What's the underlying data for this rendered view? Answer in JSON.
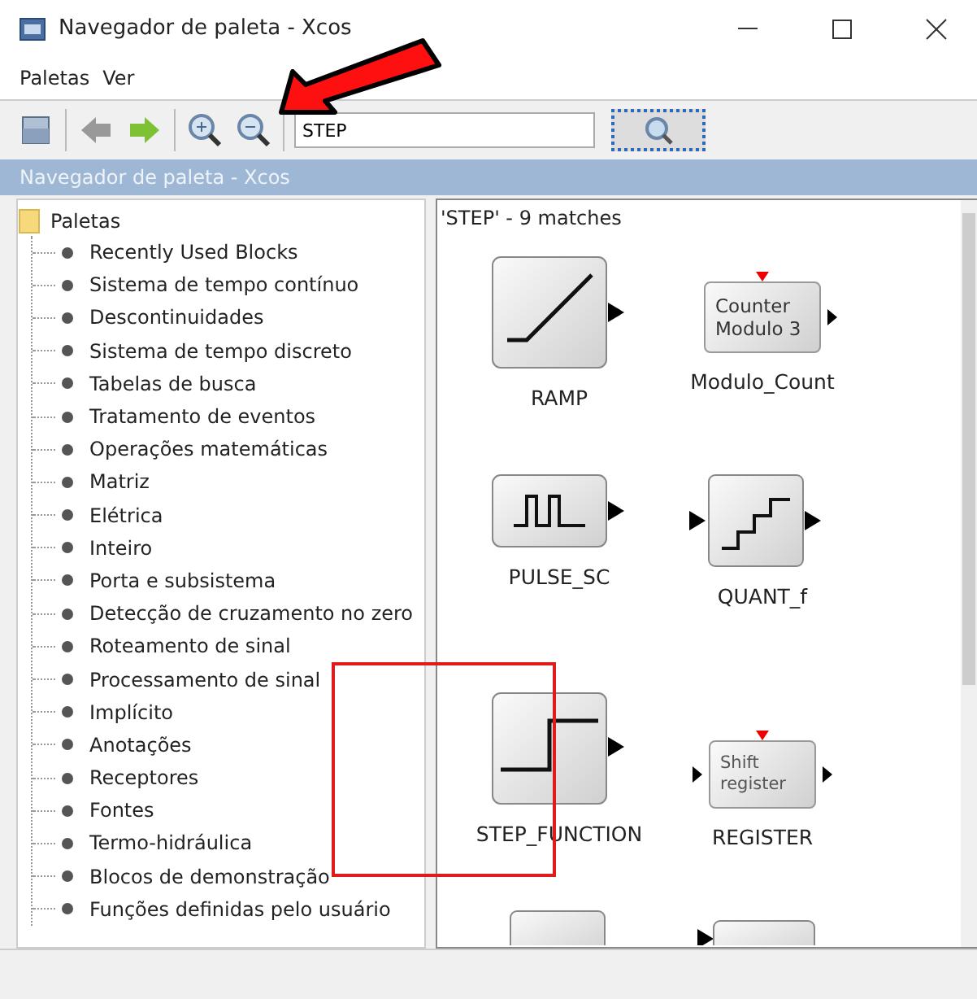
{
  "window": {
    "title": "Navegador de paleta - Xcos"
  },
  "menu": [
    "Paletas",
    "Ver"
  ],
  "search": {
    "value": "STEP"
  },
  "panel": {
    "title": "Navegador de paleta - Xcos"
  },
  "tree": {
    "label": "Paletas",
    "children": [
      {
        "label": "Recently Used Blocks"
      },
      {
        "label": "Sistema de tempo contínuo"
      },
      {
        "label": "Descontinuidades"
      },
      {
        "label": "Sistema de tempo discreto"
      },
      {
        "label": "Tabelas de busca"
      },
      {
        "label": "Tratamento de eventos"
      },
      {
        "label": "Operações matemáticas"
      },
      {
        "label": "Matriz"
      },
      {
        "label": "Elétrica"
      },
      {
        "label": "Inteiro"
      },
      {
        "label": "Porta e subsistema"
      },
      {
        "label": "Detecção de cruzamento no zero"
      },
      {
        "label": "Roteamento de sinal"
      },
      {
        "label": "Processamento de sinal"
      },
      {
        "label": "Implícito"
      },
      {
        "label": "Anotações"
      },
      {
        "label": "Receptores"
      },
      {
        "label": "Fontes"
      },
      {
        "label": "Termo-hidráulica"
      },
      {
        "label": "Blocos de demonstração"
      },
      {
        "label": "Funções definidas pelo usuário"
      }
    ]
  },
  "results": {
    "header": "'STEP' - 9 matches",
    "blocks": [
      {
        "kind": "ramp",
        "name": "RAMP"
      },
      {
        "kind": "counter",
        "name": "Modulo_Count",
        "caption": [
          "Counter",
          "Modulo 3"
        ]
      },
      {
        "kind": "pulse",
        "name": "PULSE_SC"
      },
      {
        "kind": "quant",
        "name": "QUANT_f"
      },
      {
        "kind": "step",
        "name": "STEP_FUNCTION"
      },
      {
        "kind": "register",
        "name": "REGISTER",
        "caption": [
          "Shift",
          "register"
        ]
      },
      {
        "kind": "cut_big"
      },
      {
        "kind": "cut_small"
      }
    ]
  }
}
